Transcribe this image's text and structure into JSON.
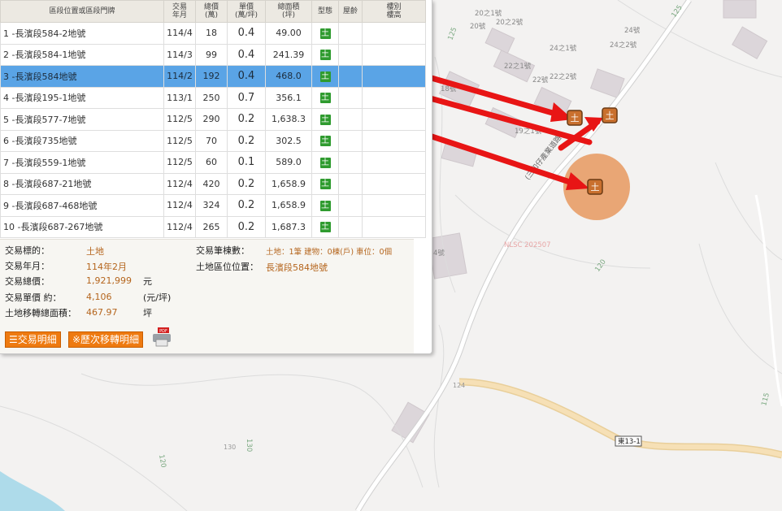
{
  "table": {
    "headers": [
      "區段位置或區段門牌",
      "交易\n年月",
      "總價\n(萬)",
      "單價\n(萬/坪)",
      "總面積\n(坪)",
      "型態",
      "屋齡",
      "樓別\n樓高"
    ],
    "rows": [
      {
        "address": "1 -長濱段584-2地號",
        "date": "114/4",
        "total": "18",
        "unit": "0.4",
        "area": "49.00",
        "type": "土"
      },
      {
        "address": "2 -長濱段584-1地號",
        "date": "114/3",
        "total": "99",
        "unit": "0.4",
        "area": "241.39",
        "type": "土"
      },
      {
        "address": "3 -長濱段584地號",
        "date": "114/2",
        "total": "192",
        "unit": "0.4",
        "area": "468.0",
        "type": "土"
      },
      {
        "address": "4 -長濱段195-1地號",
        "date": "113/1",
        "total": "250",
        "unit": "0.7",
        "area": "356.1",
        "type": "土"
      },
      {
        "address": "5 -長濱段577-7地號",
        "date": "112/5",
        "total": "290",
        "unit": "0.2",
        "area": "1,638.3",
        "type": "土"
      },
      {
        "address": "6 -長濱段735地號",
        "date": "112/5",
        "total": "70",
        "unit": "0.2",
        "area": "302.5",
        "type": "土"
      },
      {
        "address": "7 -長濱段559-1地號",
        "date": "112/5",
        "total": "60",
        "unit": "0.1",
        "area": "589.0",
        "type": "土"
      },
      {
        "address": "8 -長濱段687-21地號",
        "date": "112/4",
        "total": "420",
        "unit": "0.2",
        "area": "1,658.9",
        "type": "土"
      },
      {
        "address": "9 -長濱段687-468地號",
        "date": "112/4",
        "total": "324",
        "unit": "0.2",
        "area": "1,658.9",
        "type": "土"
      },
      {
        "address": "10 -長濱段687-267地號",
        "date": "112/4",
        "total": "265",
        "unit": "0.2",
        "area": "1,687.3",
        "type": "土"
      }
    ]
  },
  "detail": {
    "kind_label": "交易標的：",
    "kind_value": "土地",
    "month_label": "交易年月：",
    "month_value": "114年2月",
    "total_label": "交易總價：",
    "total_value": "1,921,999",
    "total_unit": "元",
    "unitprice_label": "交易單價 約：",
    "unitprice_value": "4,106",
    "unitprice_unit": "(元/坪)",
    "area_label": "土地移轉總面積：",
    "area_value": "467.97",
    "area_unit": "坪",
    "count_label": "交易筆棟數：",
    "count_value": "土地：1筆 建物：0棟(戶) 車位：0個",
    "location_label": "土地區位位置：",
    "location_value": "長濱段584地號"
  },
  "buttons": {
    "detail": "交易明細",
    "history": "※歷次移轉明細",
    "pdf": "PDF"
  },
  "map": {
    "house_labels": [
      "20之1號",
      "20之2號",
      "20號",
      "24之1號",
      "24號",
      "24之2號",
      "22之1號",
      "22號",
      "22之2號",
      "18號",
      "19之1號",
      "4號"
    ],
    "road_labels": [
      "125",
      "125",
      "120",
      "120",
      "130",
      "115",
      "124"
    ],
    "road_name": "(三和仔產業道路)",
    "road_sign": "東13-1",
    "watermark": "NLSC 202507",
    "marker_glyph": "土"
  },
  "colors": {
    "selected_row": "#5aa4e6",
    "accent_orange": "#ee7a10",
    "arrow": "#e81515",
    "value_text": "#b5651d"
  }
}
